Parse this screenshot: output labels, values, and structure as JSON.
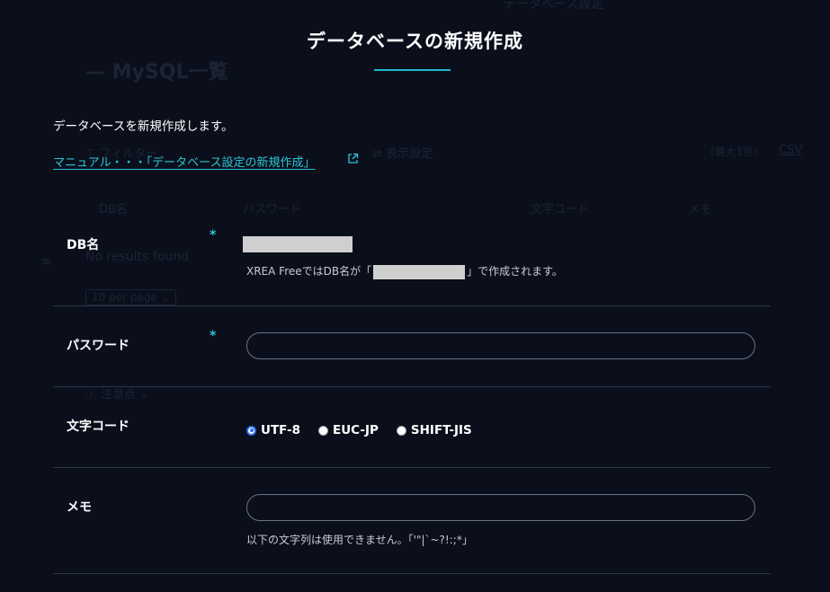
{
  "background": {
    "header_title": "データベース設定",
    "page_title": "— MySQL一覧",
    "filter": "⊤ フィルター",
    "display_settings": "⇄ 表示設定",
    "count": "(最大1件)",
    "csv": "CSV",
    "columns": [
      "DB名",
      "パスワード",
      "文字コード",
      "メモ"
    ],
    "no_results": "No results found",
    "per_page": "10 per page ⌄",
    "notes": "ⓘ 注意点 ⌄"
  },
  "modal": {
    "title": "データベースの新規作成",
    "intro": "データベースを新規作成します。",
    "manual_link": "マニュアル・・・「データベース設定の新規作成」",
    "required_mark": "*",
    "fields": {
      "dbname": {
        "label": "DB名",
        "note_prefix": "XREA FreeではDB名が「",
        "note_suffix": "」で作成されます。"
      },
      "password": {
        "label": "パスワード",
        "value": ""
      },
      "charset": {
        "label": "文字コード",
        "options": [
          "UTF-8",
          "EUC-JP",
          "SHIFT-JIS"
        ],
        "selected": "UTF-8"
      },
      "memo": {
        "label": "メモ",
        "value": "",
        "note": "以下の文字列は使用できません。「'\"|`~?!:;*」"
      }
    }
  },
  "colors": {
    "background": "#0b0f1c",
    "accent": "#2cc6d6",
    "divider": "#2e3548",
    "radio_selected": "#2b6de8"
  }
}
